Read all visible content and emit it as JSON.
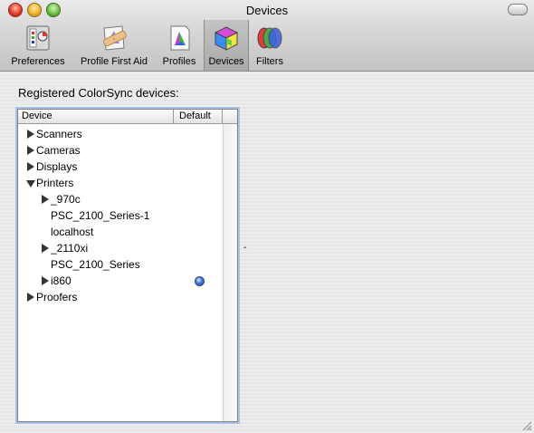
{
  "window": {
    "title": "Devices"
  },
  "toolbar": {
    "items": [
      {
        "label": "Preferences",
        "icon": "preferences-icon",
        "selected": false
      },
      {
        "label": "Profile First Aid",
        "icon": "profile-first-aid-icon",
        "selected": false
      },
      {
        "label": "Profiles",
        "icon": "profiles-icon",
        "selected": false
      },
      {
        "label": "Devices",
        "icon": "devices-icon",
        "selected": true
      },
      {
        "label": "Filters",
        "icon": "filters-icon",
        "selected": false
      }
    ]
  },
  "main": {
    "heading": "Registered ColorSync devices:",
    "table": {
      "columns": [
        "Device",
        "Default"
      ],
      "rows": [
        {
          "label": "Scanners",
          "level": 0,
          "expandable": true,
          "expanded": false
        },
        {
          "label": "Cameras",
          "level": 0,
          "expandable": true,
          "expanded": false
        },
        {
          "label": "Displays",
          "level": 0,
          "expandable": true,
          "expanded": false
        },
        {
          "label": "Printers",
          "level": 0,
          "expandable": true,
          "expanded": true
        },
        {
          "label": "_970c",
          "level": 1,
          "expandable": true,
          "expanded": false
        },
        {
          "label": "PSC_2100_Series-1",
          "level": 1,
          "expandable": false
        },
        {
          "label": "localhost",
          "level": 1,
          "expandable": false
        },
        {
          "label": "_2110xi",
          "level": 1,
          "expandable": true,
          "expanded": false
        },
        {
          "label": "PSC_2100_Series",
          "level": 1,
          "expandable": false
        },
        {
          "label": "i860",
          "level": 1,
          "expandable": true,
          "expanded": false,
          "default": true
        },
        {
          "label": "Proofers",
          "level": 0,
          "expandable": true,
          "expanded": false
        }
      ]
    }
  },
  "colors": {
    "default_indicator": "#3a6fd8",
    "selection_ring": "#a7c4e8"
  }
}
